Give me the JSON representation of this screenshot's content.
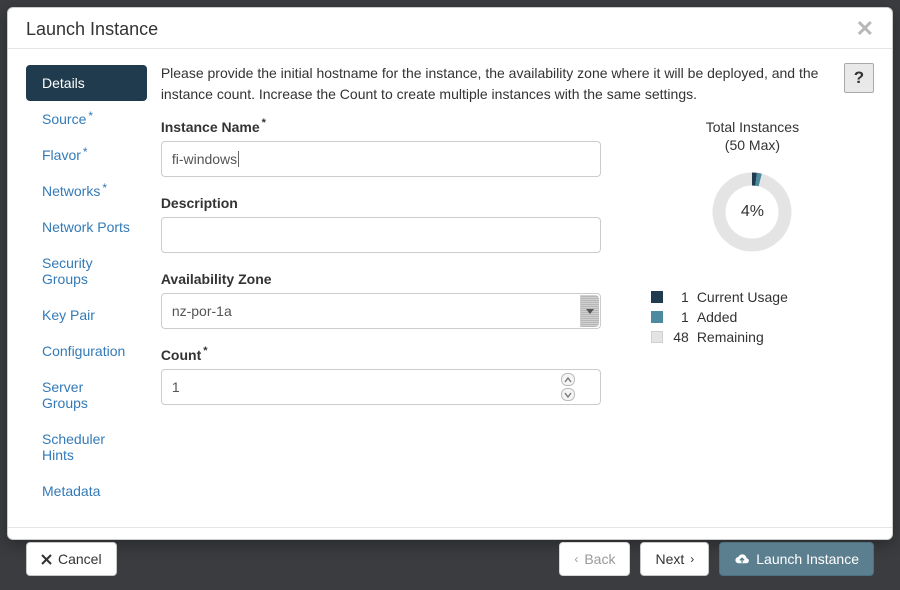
{
  "dialog": {
    "title": "Launch Instance"
  },
  "sidebar": {
    "items": [
      {
        "label": "Details",
        "required": false,
        "active": true
      },
      {
        "label": "Source",
        "required": true,
        "active": false
      },
      {
        "label": "Flavor",
        "required": true,
        "active": false
      },
      {
        "label": "Networks",
        "required": true,
        "active": false
      },
      {
        "label": "Network Ports",
        "required": false,
        "active": false
      },
      {
        "label": "Security Groups",
        "required": false,
        "active": false
      },
      {
        "label": "Key Pair",
        "required": false,
        "active": false
      },
      {
        "label": "Configuration",
        "required": false,
        "active": false
      },
      {
        "label": "Server Groups",
        "required": false,
        "active": false
      },
      {
        "label": "Scheduler Hints",
        "required": false,
        "active": false
      },
      {
        "label": "Metadata",
        "required": false,
        "active": false
      }
    ]
  },
  "help": {
    "text": "Please provide the initial hostname for the instance, the availability zone where it will be deployed, and the instance count. Increase the Count to create multiple instances with the same settings."
  },
  "form": {
    "instance_name": {
      "label": "Instance Name",
      "required": true,
      "value": "fi-windows"
    },
    "description": {
      "label": "Description",
      "required": false,
      "value": ""
    },
    "availability_zone": {
      "label": "Availability Zone",
      "required": false,
      "value": "nz-por-1a"
    },
    "count": {
      "label": "Count",
      "required": true,
      "value": "1"
    }
  },
  "quota": {
    "title": "Total Instances",
    "subtitle": "(50 Max)",
    "percent_label": "4%",
    "breakdown": [
      {
        "swatch": "#1f3b4d",
        "num": "1",
        "label": "Current Usage"
      },
      {
        "swatch": "#4c8b9f",
        "num": "1",
        "label": "Added"
      },
      {
        "swatch": "#e4e4e4",
        "num": "48",
        "label": "Remaining"
      }
    ]
  },
  "footer": {
    "cancel": "Cancel",
    "back": "Back",
    "next": "Next",
    "launch": "Launch Instance"
  },
  "chart_data": {
    "type": "pie",
    "title": "Total Instances (50 Max)",
    "series": [
      {
        "name": "Current Usage",
        "value": 1,
        "color": "#1f3b4d"
      },
      {
        "name": "Added",
        "value": 1,
        "color": "#4c8b9f"
      },
      {
        "name": "Remaining",
        "value": 48,
        "color": "#e4e4e4"
      }
    ],
    "center_label": "4%",
    "donut": true
  }
}
